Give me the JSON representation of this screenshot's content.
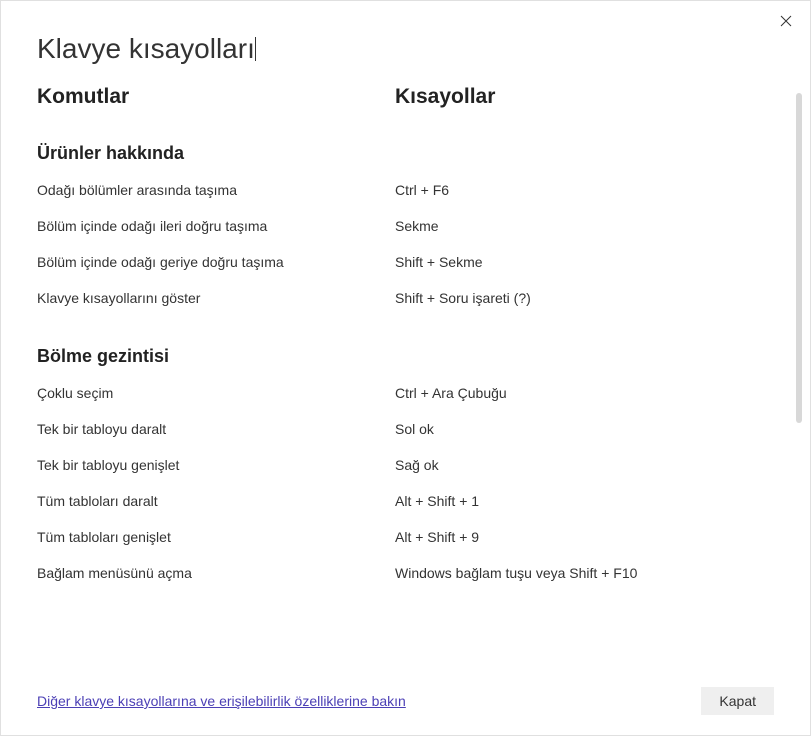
{
  "dialog": {
    "title": "Klavye kısayolları",
    "headers": {
      "commands": "Komutlar",
      "shortcuts": "Kısayollar"
    },
    "sections": [
      {
        "title": "Ürünler hakkında",
        "rows": [
          {
            "command": "Odağı bölümler arasında taşıma",
            "shortcut": "Ctrl + F6"
          },
          {
            "command": "Bölüm içinde odağı ileri doğru taşıma",
            "shortcut": "Sekme"
          },
          {
            "command": "Bölüm içinde odağı geriye doğru taşıma",
            "shortcut": "Shift + Sekme"
          },
          {
            "command": "Klavye kısayollarını göster",
            "shortcut": "Shift + Soru işareti (?)"
          }
        ]
      },
      {
        "title": "Bölme gezintisi",
        "rows": [
          {
            "command": "Çoklu seçim",
            "shortcut": "Ctrl + Ara Çubuğu"
          },
          {
            "command": "Tek bir tabloyu daralt",
            "shortcut": "Sol ok"
          },
          {
            "command": "Tek bir tabloyu genişlet",
            "shortcut": "Sağ ok"
          },
          {
            "command": "Tüm tabloları daralt",
            "shortcut": "Alt + Shift + 1"
          },
          {
            "command": "Tüm tabloları genişlet",
            "shortcut": "Alt + Shift + 9"
          },
          {
            "command": "Bağlam menüsünü açma",
            "shortcut": "Windows bağlam tuşu veya Shift + F10"
          }
        ]
      }
    ],
    "footer": {
      "link": "Diğer klavye kısayollarına ve erişilebilirlik özelliklerine bakın",
      "close": "Kapat"
    }
  }
}
